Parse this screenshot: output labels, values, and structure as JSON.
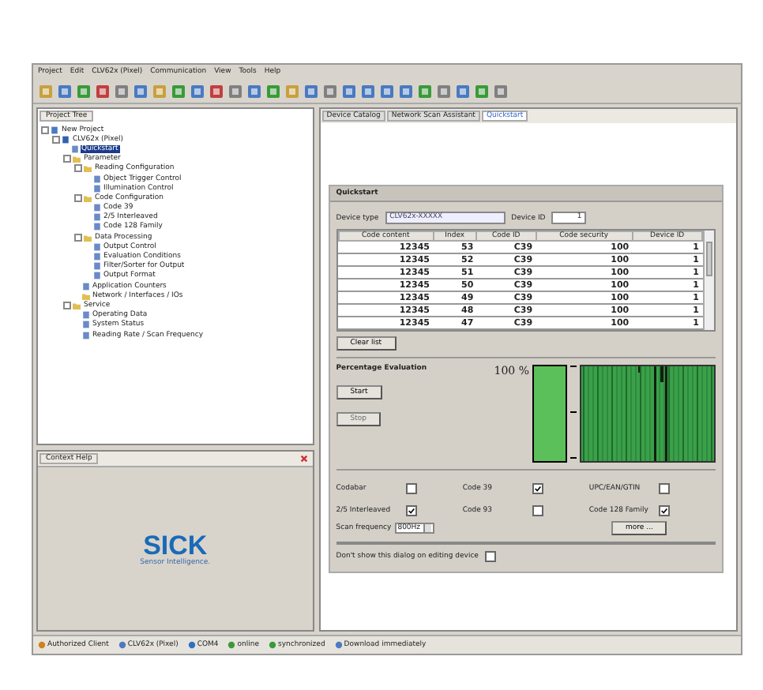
{
  "menu": [
    "Project",
    "Edit",
    "CLV62x (Pixel)",
    "Communication",
    "View",
    "Tools",
    "Help"
  ],
  "project_tree": {
    "tab": "Project Tree",
    "items": [
      {
        "label": "New Project",
        "kind": "project",
        "selected": false,
        "children": [
          {
            "label": "CLV62x (Pixel)",
            "kind": "device",
            "selected": false,
            "children": [
              {
                "label": "Quickstart",
                "kind": "page",
                "selected": true
              },
              {
                "label": "Parameter",
                "kind": "folder",
                "selected": false,
                "children": [
                  {
                    "label": "Reading Configuration",
                    "kind": "folder",
                    "selected": false,
                    "children": [
                      {
                        "label": "Object Trigger Control",
                        "kind": "page",
                        "selected": false
                      },
                      {
                        "label": "Illumination Control",
                        "kind": "page",
                        "selected": false
                      }
                    ]
                  },
                  {
                    "label": "Code Configuration",
                    "kind": "folder",
                    "selected": false,
                    "children": [
                      {
                        "label": "Code 39",
                        "kind": "page",
                        "selected": false
                      },
                      {
                        "label": "2/5 Interleaved",
                        "kind": "page",
                        "selected": false
                      },
                      {
                        "label": "Code 128 Family",
                        "kind": "page",
                        "selected": false
                      }
                    ]
                  },
                  {
                    "label": "Data Processing",
                    "kind": "folder",
                    "selected": false,
                    "children": [
                      {
                        "label": "Output Control",
                        "kind": "page",
                        "selected": false
                      },
                      {
                        "label": "Evaluation Conditions",
                        "kind": "page",
                        "selected": false
                      },
                      {
                        "label": "Filter/Sorter for Output",
                        "kind": "page",
                        "selected": false
                      },
                      {
                        "label": "Output Format",
                        "kind": "page",
                        "selected": false
                      }
                    ]
                  },
                  {
                    "label": "Application Counters",
                    "kind": "page",
                    "selected": false
                  },
                  {
                    "label": "Network / Interfaces / IOs",
                    "kind": "folder",
                    "selected": false
                  }
                ]
              },
              {
                "label": "Service",
                "kind": "folder",
                "selected": false,
                "children": [
                  {
                    "label": "Operating Data",
                    "kind": "page",
                    "selected": false
                  },
                  {
                    "label": "System Status",
                    "kind": "page",
                    "selected": false
                  },
                  {
                    "label": "Reading Rate / Scan Frequency",
                    "kind": "page",
                    "selected": false
                  }
                ]
              }
            ]
          }
        ]
      }
    ]
  },
  "context_help": {
    "tab": "Context Help",
    "logo": "SICK",
    "tagline": "Sensor Intelligence."
  },
  "tabs": [
    {
      "label": "Device Catalog",
      "selected": false
    },
    {
      "label": "Network Scan Assistant",
      "selected": false
    },
    {
      "label": "Quickstart",
      "selected": true
    }
  ],
  "quickstart": {
    "title": "Quickstart",
    "device_type": {
      "label": "Device type",
      "value": "CLV62x-XXXXX"
    },
    "device_id": {
      "label": "Device ID",
      "value": "1"
    },
    "table": {
      "columns": [
        "Code content",
        "Index",
        "Code ID",
        "Code security",
        "Device ID"
      ],
      "rows": [
        [
          "12345",
          "53",
          "C39",
          "100",
          "1"
        ],
        [
          "12345",
          "52",
          "C39",
          "100",
          "1"
        ],
        [
          "12345",
          "51",
          "C39",
          "100",
          "1"
        ],
        [
          "12345",
          "50",
          "C39",
          "100",
          "1"
        ],
        [
          "12345",
          "49",
          "C39",
          "100",
          "1"
        ],
        [
          "12345",
          "48",
          "C39",
          "100",
          "1"
        ],
        [
          "12345",
          "47",
          "C39",
          "100",
          "1"
        ]
      ]
    },
    "clear_button": "Clear list",
    "evaluation": {
      "title": "Percentage Evaluation",
      "start": {
        "label": "Start",
        "disabled": false
      },
      "stop": {
        "label": "Stop",
        "disabled": true
      },
      "reading": "100 %",
      "level": 1
    },
    "codes": [
      {
        "label": "Codabar",
        "checked": false
      },
      {
        "label": "Code 39",
        "checked": true
      },
      {
        "label": "UPC/EAN/GTIN",
        "checked": false
      },
      {
        "label": "2/5 Interleaved",
        "checked": true
      },
      {
        "label": "Code 93",
        "checked": false
      },
      {
        "label": "Code 128 Family",
        "checked": true
      }
    ],
    "scan_frequency": {
      "label": "Scan frequency",
      "value": "800Hz"
    },
    "more_button": "more ...",
    "dont_show": {
      "label": "Don't show this dialog on editing device",
      "checked": false
    }
  },
  "status_bar": [
    "Authorized Client",
    "CLV62x (Pixel)",
    "COM4",
    "online",
    "synchronized",
    "Download immediately"
  ]
}
